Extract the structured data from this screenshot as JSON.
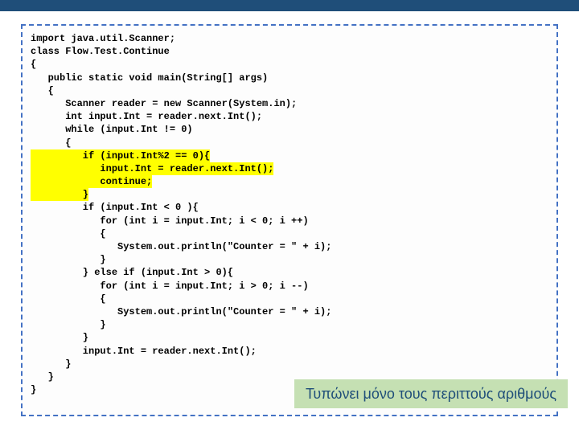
{
  "code": {
    "l0": "import java.util.Scanner;",
    "l1": "",
    "l2": "class Flow.Test.Continue",
    "l3": "{",
    "l4": "   public static void main(String[] args)",
    "l5": "   {",
    "l6": "      Scanner reader = new Scanner(System.in);",
    "l7": "      int input.Int = reader.next.Int();",
    "l8": "      while (input.Int != 0)",
    "l9": "      {",
    "h10": "         if (input.Int%2 == 0){",
    "h11": "            input.Int = reader.next.Int();",
    "h12": "            continue;",
    "h13": "         }",
    "l14": "         if (input.Int < 0 ){",
    "l15": "            for (int i = input.Int; i < 0; i ++)",
    "l16": "            {",
    "l17": "               System.out.println(\"Counter = \" + i);",
    "l18": "            }",
    "l19": "         } else if (input.Int > 0){",
    "l20": "            for (int i = input.Int; i > 0; i --)",
    "l21": "            {",
    "l22": "               System.out.println(\"Counter = \" + i);",
    "l23": "            }",
    "l24": "         }",
    "l25": "         input.Int = reader.next.Int();",
    "l26": "      }",
    "l27": "   }",
    "l28": "}"
  },
  "note": "Τυπώνει μόνο τους περιττούς αριθμούς"
}
